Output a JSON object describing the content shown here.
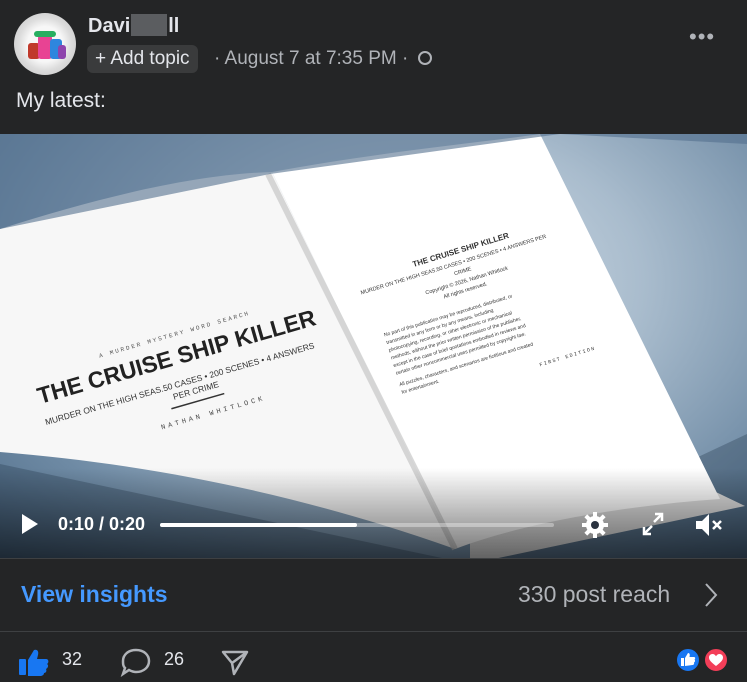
{
  "post": {
    "author_first": "Davi",
    "author_last": "ll",
    "add_topic": "+ Add topic",
    "meta": "· August 7 at 7:35 PM ·",
    "text": "My latest:"
  },
  "book": {
    "kicker": "A MURDER MYSTERY WORD SEARCH",
    "title": "THE CRUISE SHIP KILLER",
    "subtitle_1": "MURDER ON THE HIGH SEAS.50 CASES • 200 SCENES • 4 ANSWERS",
    "subtitle_2": "PER CRIME",
    "author": "NATHAN WHITLOCK",
    "right_title": "THE CRUISE SHIP KILLER",
    "right_sub_1": "MURDER ON THE HIGH SEAS.50 CASES • 200 SCENES • 4 ANSWERS PER",
    "right_sub_2": "CRIME",
    "copyright": "Copyright © 2026, Nathan Whitlock",
    "rights": "All rights reserved.",
    "legal_1": "No part of this publication may be reproduced, distributed, or",
    "legal_2": "transmitted in any form or by any means, including",
    "legal_3": "photocopying, recording, or other electronic or mechanical",
    "legal_4": "methods, without the prior written permission of the publisher,",
    "legal_5": "except in the case of brief quotations embodied in reviews and",
    "legal_6": "certain other noncommercial uses permitted by copyright law.",
    "legal_7": "All puzzles, characters, and scenarios are fictitious and created",
    "legal_8": "for entertainment.",
    "edition": "FIRST EDITION"
  },
  "video": {
    "time": "0:10 / 0:20",
    "progress": 0.5
  },
  "insights": {
    "label": "View insights",
    "reach": "330 post reach"
  },
  "actions": {
    "likes": "32",
    "comments": "26"
  },
  "colors": {
    "accent": "#4599ff",
    "like": "#1877f2",
    "love": "#f33e58"
  }
}
